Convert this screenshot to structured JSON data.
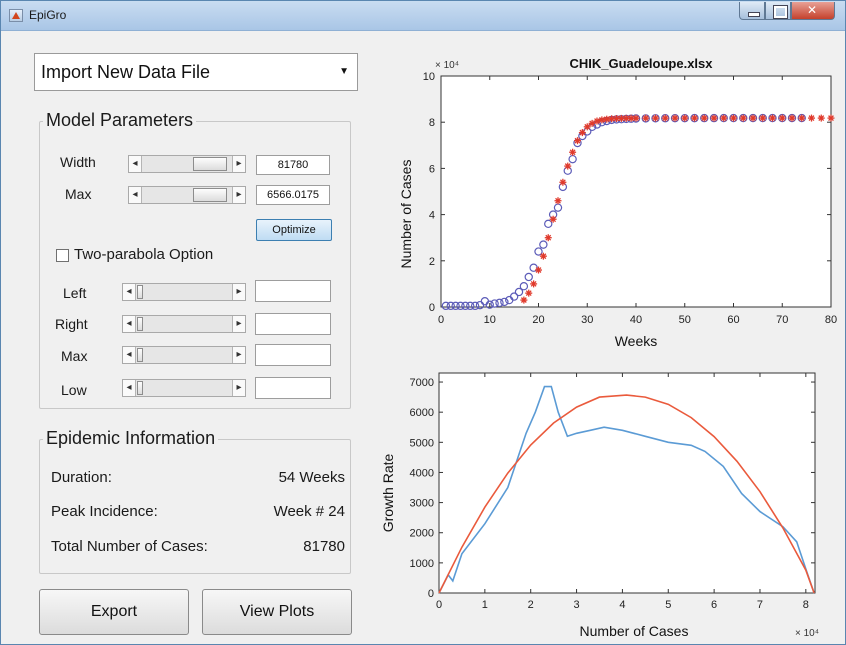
{
  "window": {
    "title": "EpiGro"
  },
  "dropdown": {
    "selected": "Import New Data File"
  },
  "model_parameters": {
    "title": "Model Parameters",
    "width_label": "Width",
    "width_value": "81780",
    "max_label": "Max",
    "max_value": "6566.0175",
    "optimize_label": "Optimize",
    "two_parabola_label": "Two-parabola Option",
    "two_parabola_checked": false,
    "left_label": "Left",
    "right_label": "Right",
    "max2_label": "Max",
    "low_label": "Low"
  },
  "epidemic": {
    "title": "Epidemic Information",
    "duration_label": "Duration:",
    "duration_value": "54 Weeks",
    "peak_label": "Peak Incidence:",
    "peak_value": "Week # 24",
    "total_label": "Total Number of Cases:",
    "total_value": "81780"
  },
  "buttons": {
    "export": "Export",
    "view_plots": "View Plots"
  },
  "chart_data": [
    {
      "type": "scatter",
      "title": "CHIK_Guadeloupe.xlsx",
      "xlabel": "Weeks",
      "ylabel": "Number of Cases",
      "y_exponent_label": "× 10⁴",
      "xlim": [
        0,
        80
      ],
      "ylim": [
        0,
        100000
      ],
      "x_ticks": [
        "0",
        "10",
        "20",
        "30",
        "40",
        "50",
        "60",
        "70",
        "80"
      ],
      "y_ticks": [
        "0",
        "2",
        "4",
        "6",
        "8",
        "10"
      ],
      "colors": {
        "observed": "#5b5bb8",
        "fitted": "#e03a2c"
      },
      "series": [
        {
          "marker": "circle",
          "x": [
            1,
            2,
            3,
            4,
            5,
            6,
            7,
            8,
            9,
            10,
            11,
            12,
            13,
            14,
            15,
            16,
            17,
            18,
            19,
            20,
            21,
            22,
            23,
            24,
            25,
            26,
            27,
            28,
            29,
            30,
            31,
            32,
            33,
            34,
            35,
            36,
            37,
            38,
            39,
            40,
            42,
            44,
            46,
            48,
            50,
            52,
            54,
            56,
            58,
            60,
            62,
            64,
            66,
            68,
            70,
            72,
            74
          ],
          "y": [
            500,
            500,
            500,
            500,
            500,
            500,
            500,
            800,
            2500,
            1000,
            1500,
            1800,
            2200,
            3000,
            4500,
            6500,
            9000,
            13000,
            17000,
            24000,
            27000,
            36000,
            40000,
            43000,
            52000,
            59000,
            64000,
            71000,
            74000,
            76000,
            78000,
            79000,
            80000,
            80500,
            81000,
            81200,
            81300,
            81400,
            81500,
            81600,
            81650,
            81700,
            81720,
            81740,
            81750,
            81760,
            81770,
            81775,
            81780,
            81780,
            81780,
            81780,
            81780,
            81780,
            81780,
            81780,
            81780
          ]
        },
        {
          "marker": "star",
          "x": [
            17,
            18,
            19,
            20,
            21,
            22,
            23,
            24,
            25,
            26,
            27,
            28,
            29,
            30,
            31,
            32,
            33,
            34,
            35,
            36,
            37,
            38,
            39,
            40,
            42,
            44,
            46,
            48,
            50,
            52,
            54,
            56,
            58,
            60,
            62,
            64,
            66,
            68,
            70,
            72,
            74,
            76,
            78,
            80
          ],
          "y": [
            3000,
            6000,
            10000,
            16000,
            22000,
            30000,
            38000,
            46000,
            54000,
            61000,
            67000,
            72000,
            75500,
            78000,
            79500,
            80500,
            81000,
            81300,
            81500,
            81600,
            81650,
            81700,
            81720,
            81740,
            81760,
            81770,
            81775,
            81780,
            81780,
            81780,
            81780,
            81780,
            81780,
            81780,
            81780,
            81780,
            81780,
            81780,
            81780,
            81780,
            81780,
            81780,
            81780,
            81780
          ]
        }
      ]
    },
    {
      "type": "line",
      "xlabel": "Number of Cases",
      "ylabel": "Growth Rate",
      "x_exponent_label": "× 10⁴",
      "xlim": [
        0,
        8.2
      ],
      "ylim": [
        0,
        7300
      ],
      "x_ticks": [
        "0",
        "1",
        "2",
        "3",
        "4",
        "5",
        "6",
        "7",
        "8"
      ],
      "y_ticks": [
        "0",
        "1000",
        "2000",
        "3000",
        "4000",
        "5000",
        "6000",
        "7000"
      ],
      "colors": {
        "observed": "#5b9bd5",
        "fitted": "#ea5a3c"
      },
      "series": [
        {
          "x": [
            0,
            0.1,
            0.2,
            0.3,
            0.5,
            1,
            1.5,
            1.9,
            2.1,
            2.3,
            2.45,
            2.6,
            2.8,
            3,
            3.3,
            3.6,
            4,
            4.5,
            5,
            5.5,
            5.8,
            6.2,
            6.6,
            7,
            7.5,
            7.8,
            8,
            8.18
          ],
          "y": [
            0,
            300,
            600,
            400,
            1300,
            2300,
            3500,
            5300,
            6000,
            6850,
            6850,
            6000,
            5200,
            5300,
            5400,
            5500,
            5400,
            5200,
            5000,
            4900,
            4700,
            4200,
            3300,
            2700,
            2200,
            1700,
            800,
            0
          ]
        },
        {
          "x": [
            0,
            0.5,
            1,
            1.5,
            2,
            2.5,
            3,
            3.5,
            4.09,
            4.5,
            5,
            5.5,
            6,
            6.5,
            7,
            7.5,
            8,
            8.18
          ],
          "y": [
            0,
            1520,
            2850,
            3980,
            4910,
            5640,
            6170,
            6500,
            6566,
            6500,
            6260,
            5820,
            5190,
            4370,
            3360,
            2160,
            760,
            0
          ]
        }
      ]
    }
  ]
}
